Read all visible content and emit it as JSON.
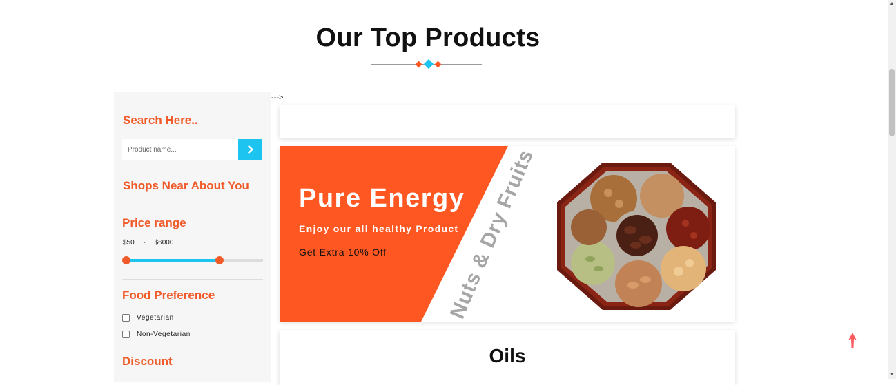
{
  "header": {
    "title": "Our Top Products"
  },
  "stray_text": "--->",
  "sidebar": {
    "search_heading": "Search Here..",
    "search_placeholder": "Product name...",
    "shops_heading": "Shops Near About You",
    "price_heading": "Price range",
    "price_min": "$50",
    "price_sep": "-",
    "price_max": "$6000",
    "price_low_fraction": 0.0,
    "price_high_fraction": 0.68,
    "food_heading": "Food Preference",
    "food_options": [
      {
        "label": "Vegetarian",
        "checked": false
      },
      {
        "label": "Non-Vegetarian",
        "checked": false
      }
    ],
    "discount_heading": "Discount"
  },
  "banner": {
    "title": "Pure Energy",
    "subtitle": "Enjoy our all healthy Product",
    "offer": "Get Extra 10% Off",
    "vertical_text": "Nuts & Dry Fruits"
  },
  "section": {
    "oils_title": "Oils"
  },
  "colors": {
    "accent": "#f05a28",
    "banner_orange": "#ff5722",
    "cyan": "#1ec4f0"
  },
  "icons": {
    "search_button": "chevron-right-icon",
    "back_to_top": "arrow-up-icon"
  }
}
